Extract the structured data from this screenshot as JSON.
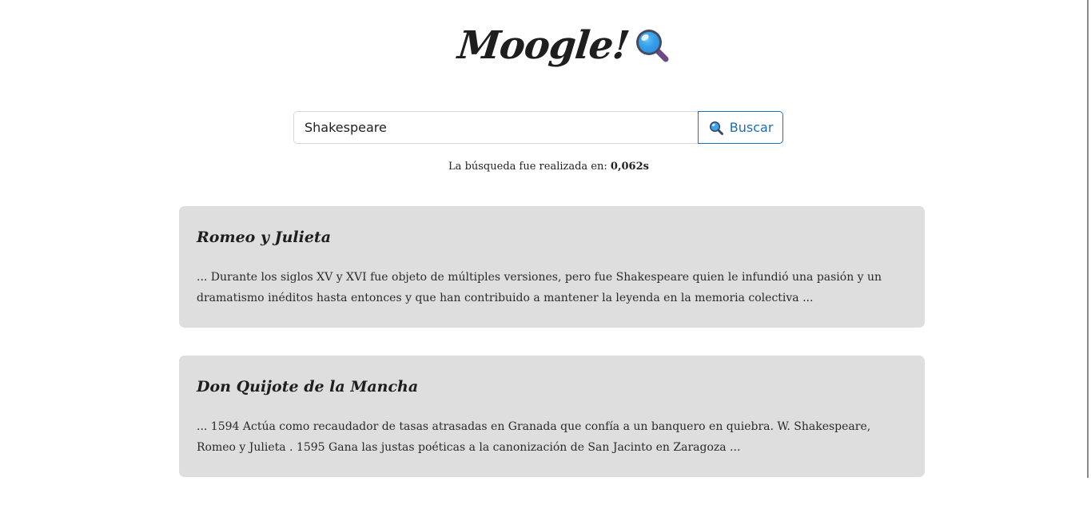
{
  "logo": {
    "text": "Moogle!",
    "icon": "magnifying-glass-icon"
  },
  "search": {
    "value": "Shakespeare",
    "placeholder": "",
    "button_label": "Buscar",
    "button_icon": "search-icon"
  },
  "timing": {
    "prefix": "La búsqueda fue realizada en:",
    "value": "0,062s"
  },
  "results": [
    {
      "title": "Romeo y Julieta",
      "snippet": "... Durante los siglos XV y XVI fue objeto de múltiples versiones, pero fue Shakespeare quien le infundió una pasión y un dramatismo inéditos hasta entonces y que han contribuido a mantener la leyenda en la memoria colectiva ..."
    },
    {
      "title": "Don Quijote de la Mancha",
      "snippet": "...  1594  Actúa como recaudador de tasas atrasadas en Granada que confía a un banquero en quiebra.  W. Shakespeare,  Romeo y Julieta  . 1595   Gana las justas poéticas a la canonización de San Jacinto en Zaragoza ..."
    }
  ],
  "colors": {
    "accent": "#1a6fb5",
    "card_background": "#dedede"
  }
}
